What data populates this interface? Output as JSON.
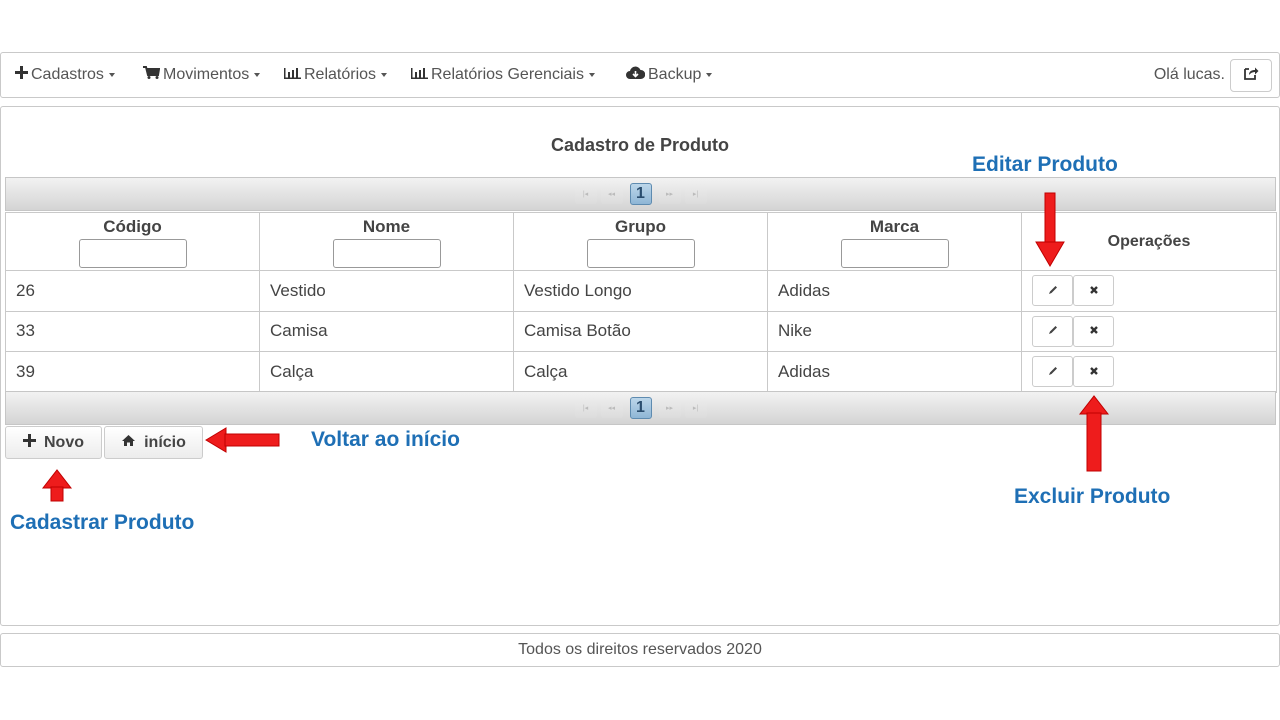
{
  "navbar": {
    "items": [
      {
        "label": "Cadastros",
        "icon": "plus-icon"
      },
      {
        "label": "Movimentos",
        "icon": "cart-icon"
      },
      {
        "label": "Relatórios",
        "icon": "bar-chart-icon"
      },
      {
        "label": "Relatórios Gerenciais",
        "icon": "bar-chart-icon"
      },
      {
        "label": "Backup",
        "icon": "cloud-download-icon"
      }
    ],
    "greeting": "Olá lucas.",
    "logout_icon": "share-icon"
  },
  "page": {
    "title": "Cadastro de Produto"
  },
  "paginator": {
    "current_page": "1"
  },
  "table": {
    "columns": [
      "Código",
      "Nome",
      "Grupo",
      "Marca",
      "Operações"
    ],
    "rows": [
      {
        "codigo": "26",
        "nome": "Vestido",
        "grupo": "Vestido Longo",
        "marca": "Adidas"
      },
      {
        "codigo": "33",
        "nome": "Camisa",
        "grupo": "Camisa Botão",
        "marca": "Nike"
      },
      {
        "codigo": "39",
        "nome": "Calça",
        "grupo": "Calça",
        "marca": "Adidas"
      }
    ]
  },
  "actions": {
    "new_label": "Novo",
    "home_label": "início"
  },
  "annotations": {
    "edit": "Editar Produto",
    "delete": "Excluir Produto",
    "back": "Voltar ao início",
    "create": "Cadastrar Produto",
    "arrow_color": "#ee1c1c",
    "text_color": "#1e6fb5"
  },
  "footer": {
    "text": "Todos os direitos reservados 2020"
  }
}
